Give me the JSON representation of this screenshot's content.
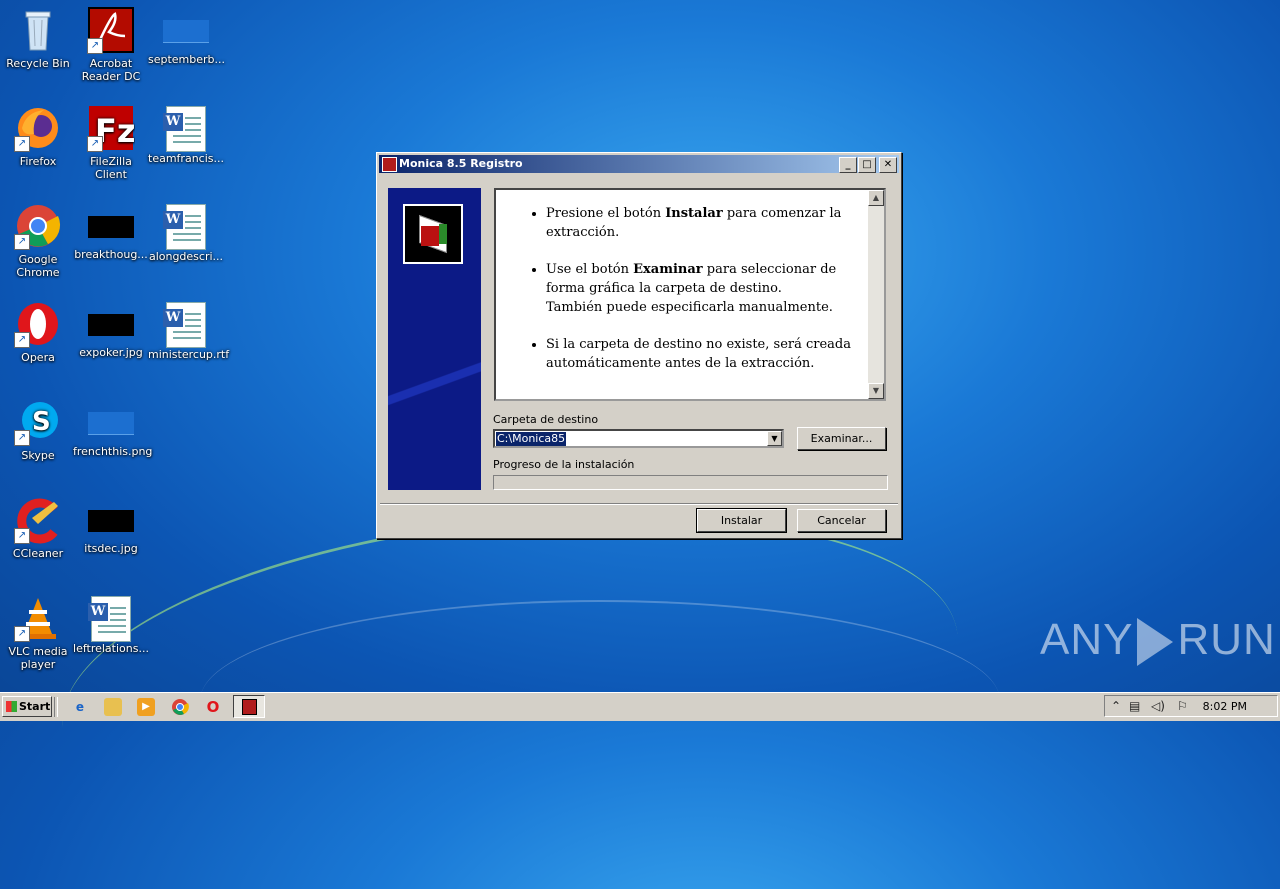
{
  "desktop": {
    "icons": [
      {
        "label": "Recycle Bin"
      },
      {
        "label": "Acrobat Reader DC"
      },
      {
        "label": "septemberb..."
      },
      {
        "label": "Firefox"
      },
      {
        "label": "FileZilla Client"
      },
      {
        "label": "teamfrancis..."
      },
      {
        "label": "Google Chrome"
      },
      {
        "label": "breakthoug..."
      },
      {
        "label": "alongdescri..."
      },
      {
        "label": "Opera"
      },
      {
        "label": "expoker.jpg"
      },
      {
        "label": "ministercup.rtf"
      },
      {
        "label": "Skype"
      },
      {
        "label": "frenchthis.png"
      },
      {
        "label": "CCleaner"
      },
      {
        "label": "itsdec.jpg"
      },
      {
        "label": "VLC media player"
      },
      {
        "label": "leftrelations..."
      }
    ]
  },
  "dialog": {
    "title": "Monica 8.5 Registro",
    "instructions": {
      "b1_pre": "Presione el botón ",
      "b1_bold": "Instalar",
      "b1_post": " para comenzar la extracción.",
      "b2_pre": "Use el botón ",
      "b2_bold": "Examinar",
      "b2_post": " para seleccionar de forma gráfica la carpeta de destino.",
      "b2_line2": "También puede especificarla manualmente.",
      "b3": "Si la carpeta de destino no existe, será creada automáticamente antes de la extracción."
    },
    "dest_label": "Carpeta de destino",
    "dest_value": "C:\\Monica85",
    "browse_label": "Examinar...",
    "progress_label": "Progreso de la instalación",
    "progress_value": 0,
    "install_label": "Instalar",
    "cancel_label": "Cancelar"
  },
  "taskbar": {
    "start_label": "Start",
    "clock": "8:02 PM"
  },
  "watermark": {
    "left": "ANY",
    "right": "RUN"
  }
}
